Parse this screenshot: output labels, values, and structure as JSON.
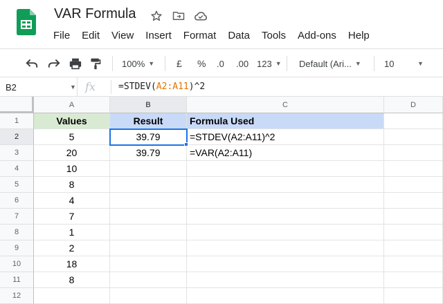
{
  "app": {
    "title": "VAR Formula",
    "brand_color": "#0F9D58"
  },
  "menu": [
    "File",
    "Edit",
    "View",
    "Insert",
    "Format",
    "Data",
    "Tools",
    "Add-ons",
    "Help"
  ],
  "toolbar": {
    "zoom": "100%",
    "currency": "£",
    "percent": "%",
    "decrease_decimal": ".0",
    "increase_decimal": ".00",
    "more_formats": "123",
    "font": "Default (Ari...",
    "font_size": "10"
  },
  "formula_bar": {
    "cell_ref": "B2",
    "fx": "fx",
    "formula_prefix": "=STDEV(",
    "formula_range": "A2:A11",
    "formula_suffix": ")^2"
  },
  "columns": [
    "A",
    "B",
    "C",
    "D"
  ],
  "rows": [
    "1",
    "2",
    "3",
    "4",
    "5",
    "6",
    "7",
    "8",
    "9",
    "10",
    "11",
    "12"
  ],
  "headers": {
    "a": "Values",
    "b": "Result",
    "c": "Formula Used",
    "a_bg": "#D9EAD3",
    "bc_bg": "#C9DAF8"
  },
  "values": [
    "5",
    "20",
    "10",
    "8",
    "4",
    "7",
    "1",
    "2",
    "18",
    "8"
  ],
  "results": [
    "39.79",
    "39.79"
  ],
  "formulas": [
    "=STDEV(A2:A11)^2",
    "=VAR(A2:A11)"
  ],
  "selection": {
    "accent": "#1A73E8"
  }
}
